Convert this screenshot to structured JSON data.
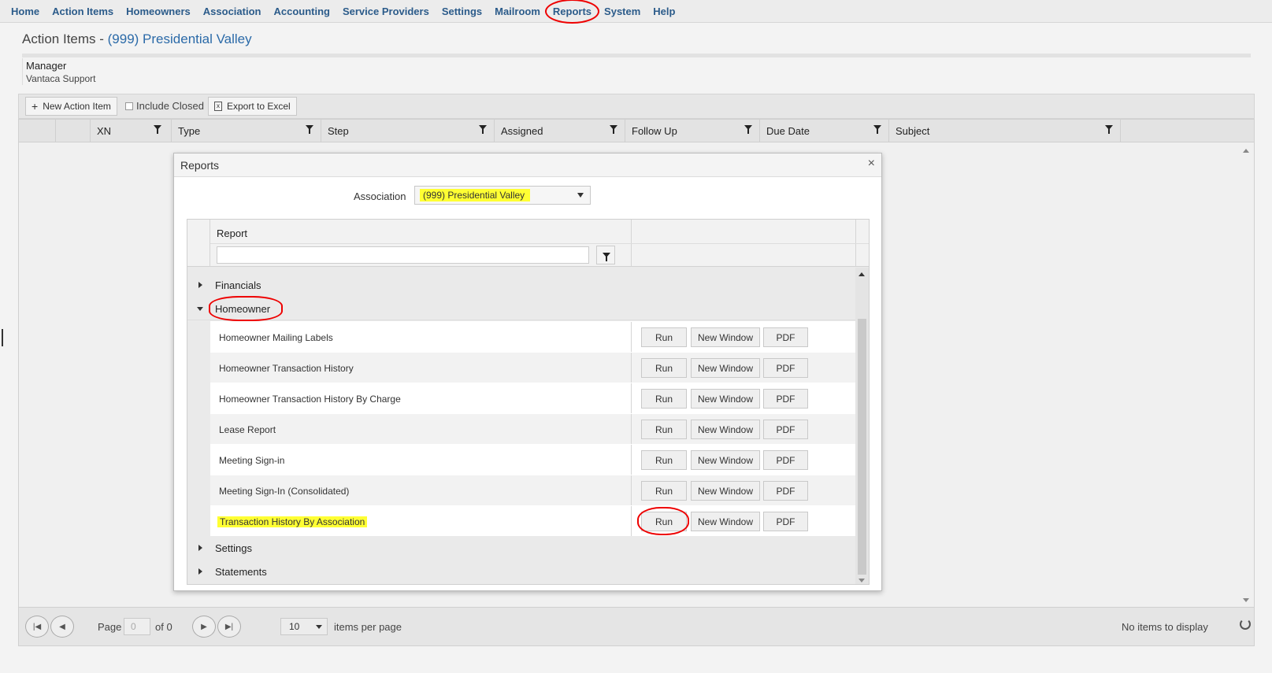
{
  "nav": [
    "Home",
    "Action Items",
    "Homeowners",
    "Association",
    "Accounting",
    "Service Providers",
    "Settings",
    "Mailroom",
    "Reports",
    "System",
    "Help"
  ],
  "page": {
    "title_prefix": "Action Items - ",
    "title_assoc": "(999) Presidential Valley",
    "manager_label": "Manager",
    "manager_value": "Vantaca Support"
  },
  "toolbar": {
    "new_action_item": "New Action Item",
    "include_closed": "Include Closed",
    "export_excel": "Export to Excel"
  },
  "grid": {
    "columns": [
      "XN",
      "Type",
      "Step",
      "Assigned",
      "Follow Up",
      "Due Date",
      "Subject"
    ]
  },
  "pager": {
    "page_label": "Page",
    "page_value": "0",
    "of_label": "of 0",
    "per_page": "10",
    "per_page_label": "items per page",
    "status": "No items to display"
  },
  "modal": {
    "title": "Reports",
    "close": "×",
    "association_label": "Association",
    "association_value": "(999) Presidential Valley",
    "report_header": "Report",
    "groups": {
      "financials": "Financials",
      "homeowner": "Homeowner",
      "settings": "Settings",
      "statements": "Statements"
    },
    "reports": [
      "Homeowner Mailing Labels",
      "Homeowner Transaction History",
      "Homeowner Transaction History By Charge",
      "Lease Report",
      "Meeting Sign-in",
      "Meeting Sign-In (Consolidated)",
      "Transaction History By Association"
    ],
    "btn_run": "Run",
    "btn_new_window": "New Window",
    "btn_pdf": "PDF"
  },
  "colors": {
    "nav_text": "#2b5b8a",
    "highlight": "#ffff33",
    "annotation": "#e00000"
  }
}
